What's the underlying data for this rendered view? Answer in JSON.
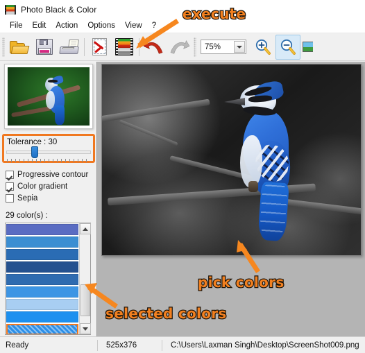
{
  "window": {
    "title": "Photo Black & Color",
    "icon": "film-strip-icon"
  },
  "menu": {
    "items": [
      {
        "label": "File"
      },
      {
        "label": "Edit"
      },
      {
        "label": "Action"
      },
      {
        "label": "Options"
      },
      {
        "label": "View"
      },
      {
        "label": "?"
      }
    ]
  },
  "toolbar": {
    "buttons": [
      {
        "name": "open-file-button",
        "icon": "open-folder-icon",
        "tooltip": "Open"
      },
      {
        "name": "save-file-button",
        "icon": "floppy-disk-icon",
        "tooltip": "Save"
      },
      {
        "name": "print-button",
        "icon": "printer-icon",
        "tooltip": "Print"
      },
      {
        "name": "reset-button",
        "icon": "page-cancel-icon",
        "tooltip": "Reset"
      },
      {
        "name": "execute-button",
        "icon": "film-strip-icon",
        "tooltip": "Execute"
      },
      {
        "name": "undo-button",
        "icon": "undo-arrow-icon",
        "tooltip": "Undo"
      },
      {
        "name": "redo-button",
        "icon": "redo-arrow-icon",
        "tooltip": "Redo"
      },
      {
        "name": "zoom-in-button",
        "icon": "magnifier-plus-icon",
        "tooltip": "Zoom in"
      },
      {
        "name": "zoom-out-button",
        "icon": "magnifier-minus-icon",
        "tooltip": "Zoom out"
      },
      {
        "name": "fit-image-button",
        "icon": "resize-image-icon",
        "tooltip": "Fit"
      }
    ],
    "zoom_value": "75%"
  },
  "left_panel": {
    "thumbnail_alt": "Original photo thumbnail - blue jay on branch",
    "tolerance": {
      "label": "Tolerance : 30",
      "value": 30,
      "min": 0,
      "max": 100,
      "highlight_color": "#f07820"
    },
    "checkboxes": [
      {
        "label": "Progressive contour",
        "checked": true
      },
      {
        "label": "Color gradient",
        "checked": true
      },
      {
        "label": "Sepia",
        "checked": false
      }
    ],
    "color_count_label": "29 color(s) :",
    "color_count": 29,
    "colors": [
      {
        "hex": "#5a6cc2",
        "selected": false
      },
      {
        "hex": "#3b8ed2",
        "selected": false
      },
      {
        "hex": "#2a6cb4",
        "selected": false
      },
      {
        "hex": "#25518f",
        "selected": false
      },
      {
        "hex": "#2f6bb0",
        "selected": false
      },
      {
        "hex": "#3d95e4",
        "selected": false
      },
      {
        "hex": "#a8cef2",
        "selected": false
      },
      {
        "hex": "#1d90ef",
        "selected": false
      },
      {
        "hex": "#2c8fe8",
        "selected": true
      }
    ]
  },
  "canvas": {
    "image_alt": "Blue jay in selective color on black and white background"
  },
  "statusbar": {
    "status": "Ready",
    "dimensions": "525x376",
    "file_path": "C:\\Users\\Laxman Singh\\Desktop\\ScreenShot009.png"
  },
  "annotations": [
    {
      "text": "execute",
      "target": "execute-button"
    },
    {
      "text": "pick colors",
      "target": "canvas"
    },
    {
      "text": "selected colors",
      "target": "color-list"
    }
  ],
  "colors": {
    "annotation_orange": "#f6871f",
    "highlight_orange": "#f07820",
    "canvas_background": "#b4b4b4",
    "panel_background": "#f0f0f0"
  }
}
